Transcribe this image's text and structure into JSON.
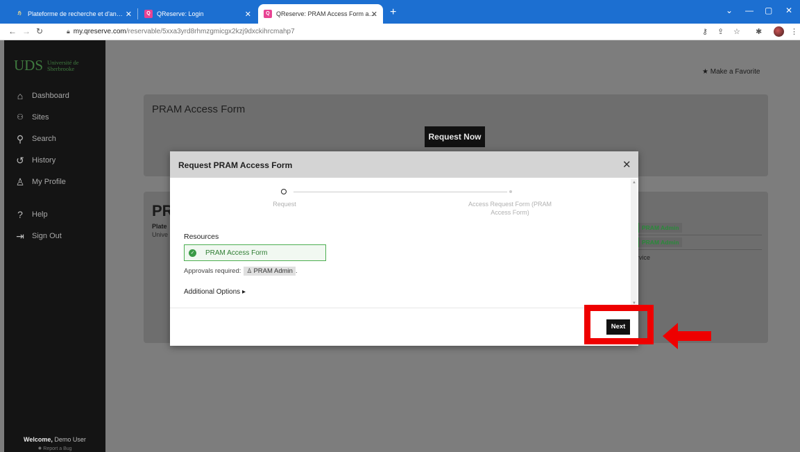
{
  "browser": {
    "tabs": [
      {
        "title": "Plateforme de recherche et d'an…",
        "favicon": "uds-favicon"
      },
      {
        "title": "QReserve: Login",
        "favicon": "qreserve-favicon"
      },
      {
        "title": "QReserve: PRAM Access Form a…",
        "favicon": "qreserve-favicon"
      }
    ],
    "url_host": "my.qreserve.com",
    "url_path": "/reservable/5xxa3yrd8rhmzgmicgx2kzj9dxckihrcmahp7"
  },
  "sidebar": {
    "logo_short": "UDS",
    "logo_full": "Université de Sherbrooke",
    "items": [
      {
        "label": "Dashboard",
        "icon": "home-icon"
      },
      {
        "label": "Sites",
        "icon": "sites-icon"
      },
      {
        "label": "Search",
        "icon": "search-icon"
      },
      {
        "label": "History",
        "icon": "history-icon"
      },
      {
        "label": "My Profile",
        "icon": "user-icon"
      },
      {
        "label": "Help",
        "icon": "help-icon"
      },
      {
        "label": "Sign Out",
        "icon": "sign-out-icon"
      }
    ],
    "welcome_prefix": "Welcome,",
    "welcome_user": "Demo User",
    "report_bug": "Report a Bug"
  },
  "page": {
    "favorite_label": "Make a Favorite",
    "form_title": "PRAM Access Form",
    "request_now": "Request Now",
    "bg_title": "PR",
    "bg_sub1": "Plate",
    "bg_sub2": "Unive",
    "admin_chip1": "PRAM Admin",
    "admin_chip2": "PRAM Admin",
    "bg_service": "rvice"
  },
  "modal": {
    "title": "Request PRAM Access Form",
    "steps": [
      {
        "label": "Request"
      },
      {
        "label": "Access Request Form (PRAM Access Form)"
      }
    ],
    "resources_label": "Resources",
    "resource_name": "PRAM Access Form",
    "approvals_label": "Approvals required:",
    "approver": "PRAM Admin",
    "approvals_suffix": ".",
    "additional_options": "Additional Options ▸",
    "next_label": "Next"
  },
  "colors": {
    "annotation": "#ee0000",
    "brand_green": "#3f7a3f",
    "tab_bar": "#1c6fd1"
  }
}
